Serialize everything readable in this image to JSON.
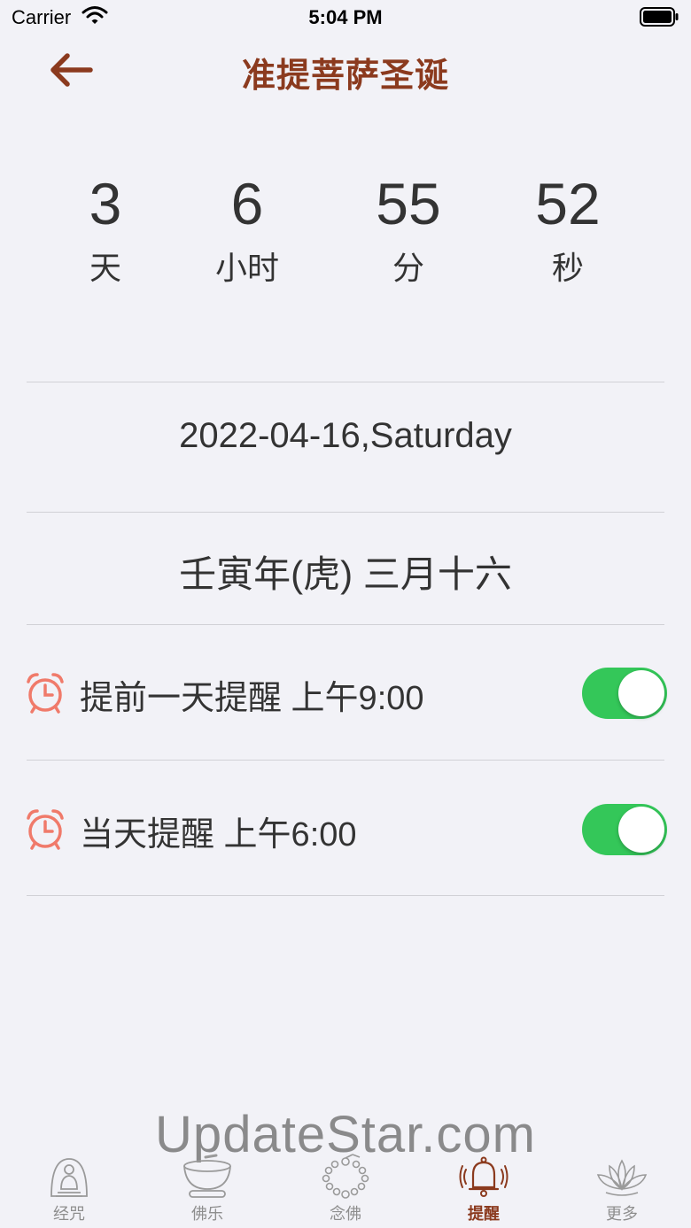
{
  "status": {
    "carrier": "Carrier",
    "time": "5:04 PM"
  },
  "nav": {
    "title": "准提菩萨圣诞",
    "back_icon": "arrow-left-icon"
  },
  "countdown": {
    "days": "3",
    "days_label": "天",
    "hours": "6",
    "hours_label": "小时",
    "minutes": "55",
    "minutes_label": "分",
    "seconds": "52",
    "seconds_label": "秒"
  },
  "date": {
    "gregorian": "2022-04-16,Saturday",
    "lunar": "壬寅年(虎) 三月十六"
  },
  "reminders": [
    {
      "label": "提前一天提醒 上午9:00",
      "enabled": true,
      "icon": "alarm-clock-icon"
    },
    {
      "label": "当天提醒 上午6:00",
      "enabled": true,
      "icon": "alarm-clock-icon"
    }
  ],
  "watermark": "UpdateStar.com",
  "tabs": [
    {
      "label": "经咒",
      "icon": "buddha-icon",
      "active": false
    },
    {
      "label": "佛乐",
      "icon": "singing-bowl-icon",
      "active": false
    },
    {
      "label": "念佛",
      "icon": "prayer-beads-icon",
      "active": false
    },
    {
      "label": "提醒",
      "icon": "bell-icon",
      "active": true
    },
    {
      "label": "更多",
      "icon": "lotus-icon",
      "active": false
    }
  ],
  "colors": {
    "accent": "#8b3a1e",
    "toggle_on": "#34c759",
    "alarm": "#f07a6a",
    "background": "#f2f2f7"
  }
}
